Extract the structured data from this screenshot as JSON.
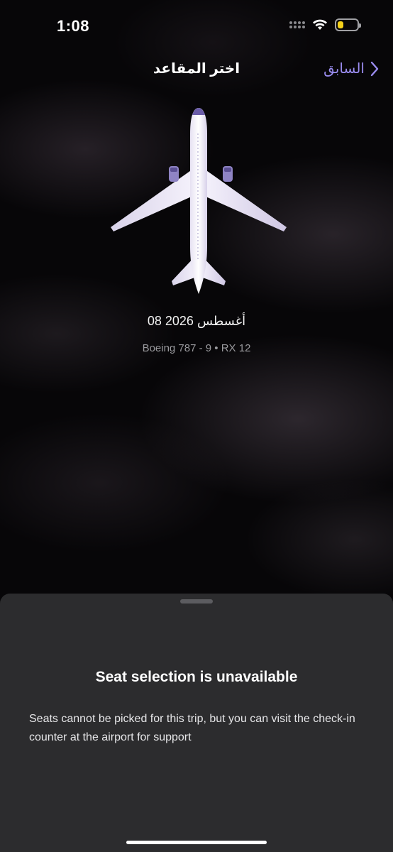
{
  "status_bar": {
    "time": "1:08",
    "battery_level": 0.3
  },
  "header": {
    "title": "اختر المقاعد",
    "back_label": "السابق"
  },
  "flight": {
    "date": "08 أغسطس 2026",
    "aircraft": "Boeing 787 - 9 • RX 12"
  },
  "sheet": {
    "title": "Seat selection is unavailable",
    "message": "Seats cannot be picked for this trip, but you can visit the check-in counter at the airport for support"
  },
  "colors": {
    "accent": "#9a8cf0",
    "sheet_bg": "#2c2c2e",
    "battery": "#f4d11a"
  },
  "icons": [
    "cellular-icon",
    "wifi-icon",
    "battery-icon",
    "chevron-right-icon",
    "airplane-icon"
  ]
}
